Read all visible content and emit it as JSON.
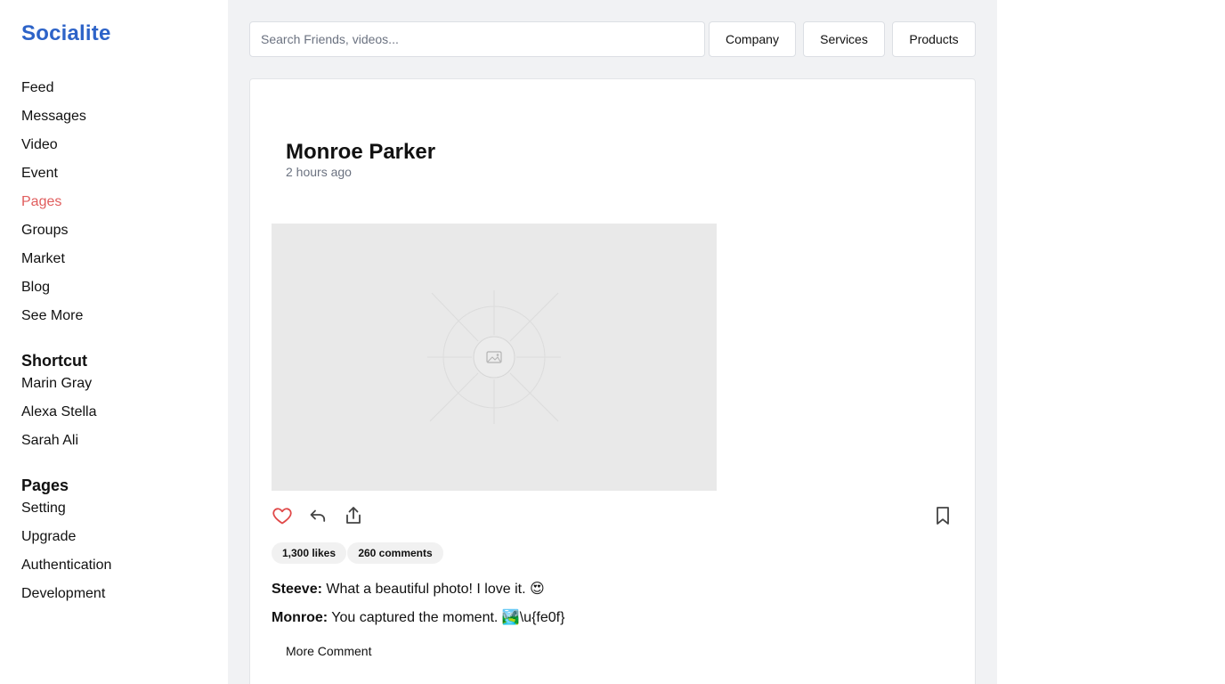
{
  "app": {
    "title": "Socialite"
  },
  "nav": {
    "items": [
      {
        "label": "Feed"
      },
      {
        "label": "Messages"
      },
      {
        "label": "Video"
      },
      {
        "label": "Event"
      },
      {
        "label": "Pages",
        "active": true
      },
      {
        "label": "Groups"
      },
      {
        "label": "Market"
      },
      {
        "label": "Blog"
      },
      {
        "label": "See More"
      }
    ]
  },
  "shortcut": {
    "title": "Shortcut",
    "items": [
      {
        "label": "Marin Gray"
      },
      {
        "label": "Alexa Stella"
      },
      {
        "label": "Sarah Ali"
      }
    ]
  },
  "pages": {
    "title": "Pages",
    "items": [
      {
        "label": "Setting"
      },
      {
        "label": "Upgrade"
      },
      {
        "label": "Authentication"
      },
      {
        "label": "Development"
      }
    ]
  },
  "header": {
    "search_placeholder": "Search Friends, videos...",
    "buttons": [
      {
        "label": "Company"
      },
      {
        "label": "Services"
      },
      {
        "label": "Products"
      }
    ]
  },
  "post": {
    "author": "Monroe Parker",
    "time": "2 hours ago",
    "image_icon": "image-placeholder-icon",
    "actions": {
      "like_icon": "heart-icon",
      "reply_icon": "reply-icon",
      "share_icon": "share-icon",
      "bookmark_icon": "bookmark-icon"
    },
    "likes": "1,300 likes",
    "comments_count": "260 comments",
    "comments": [
      {
        "author": "Steeve:",
        "text": "What a beautiful photo! I love it. 😍"
      },
      {
        "author": "Monroe:",
        "text": "You captured the moment. 🏞️\\u{fe0f}"
      }
    ],
    "more_label": "More Comment"
  },
  "colors": {
    "brand": "#2d63c8",
    "active": "#e05d5d",
    "like": "#e04848"
  }
}
